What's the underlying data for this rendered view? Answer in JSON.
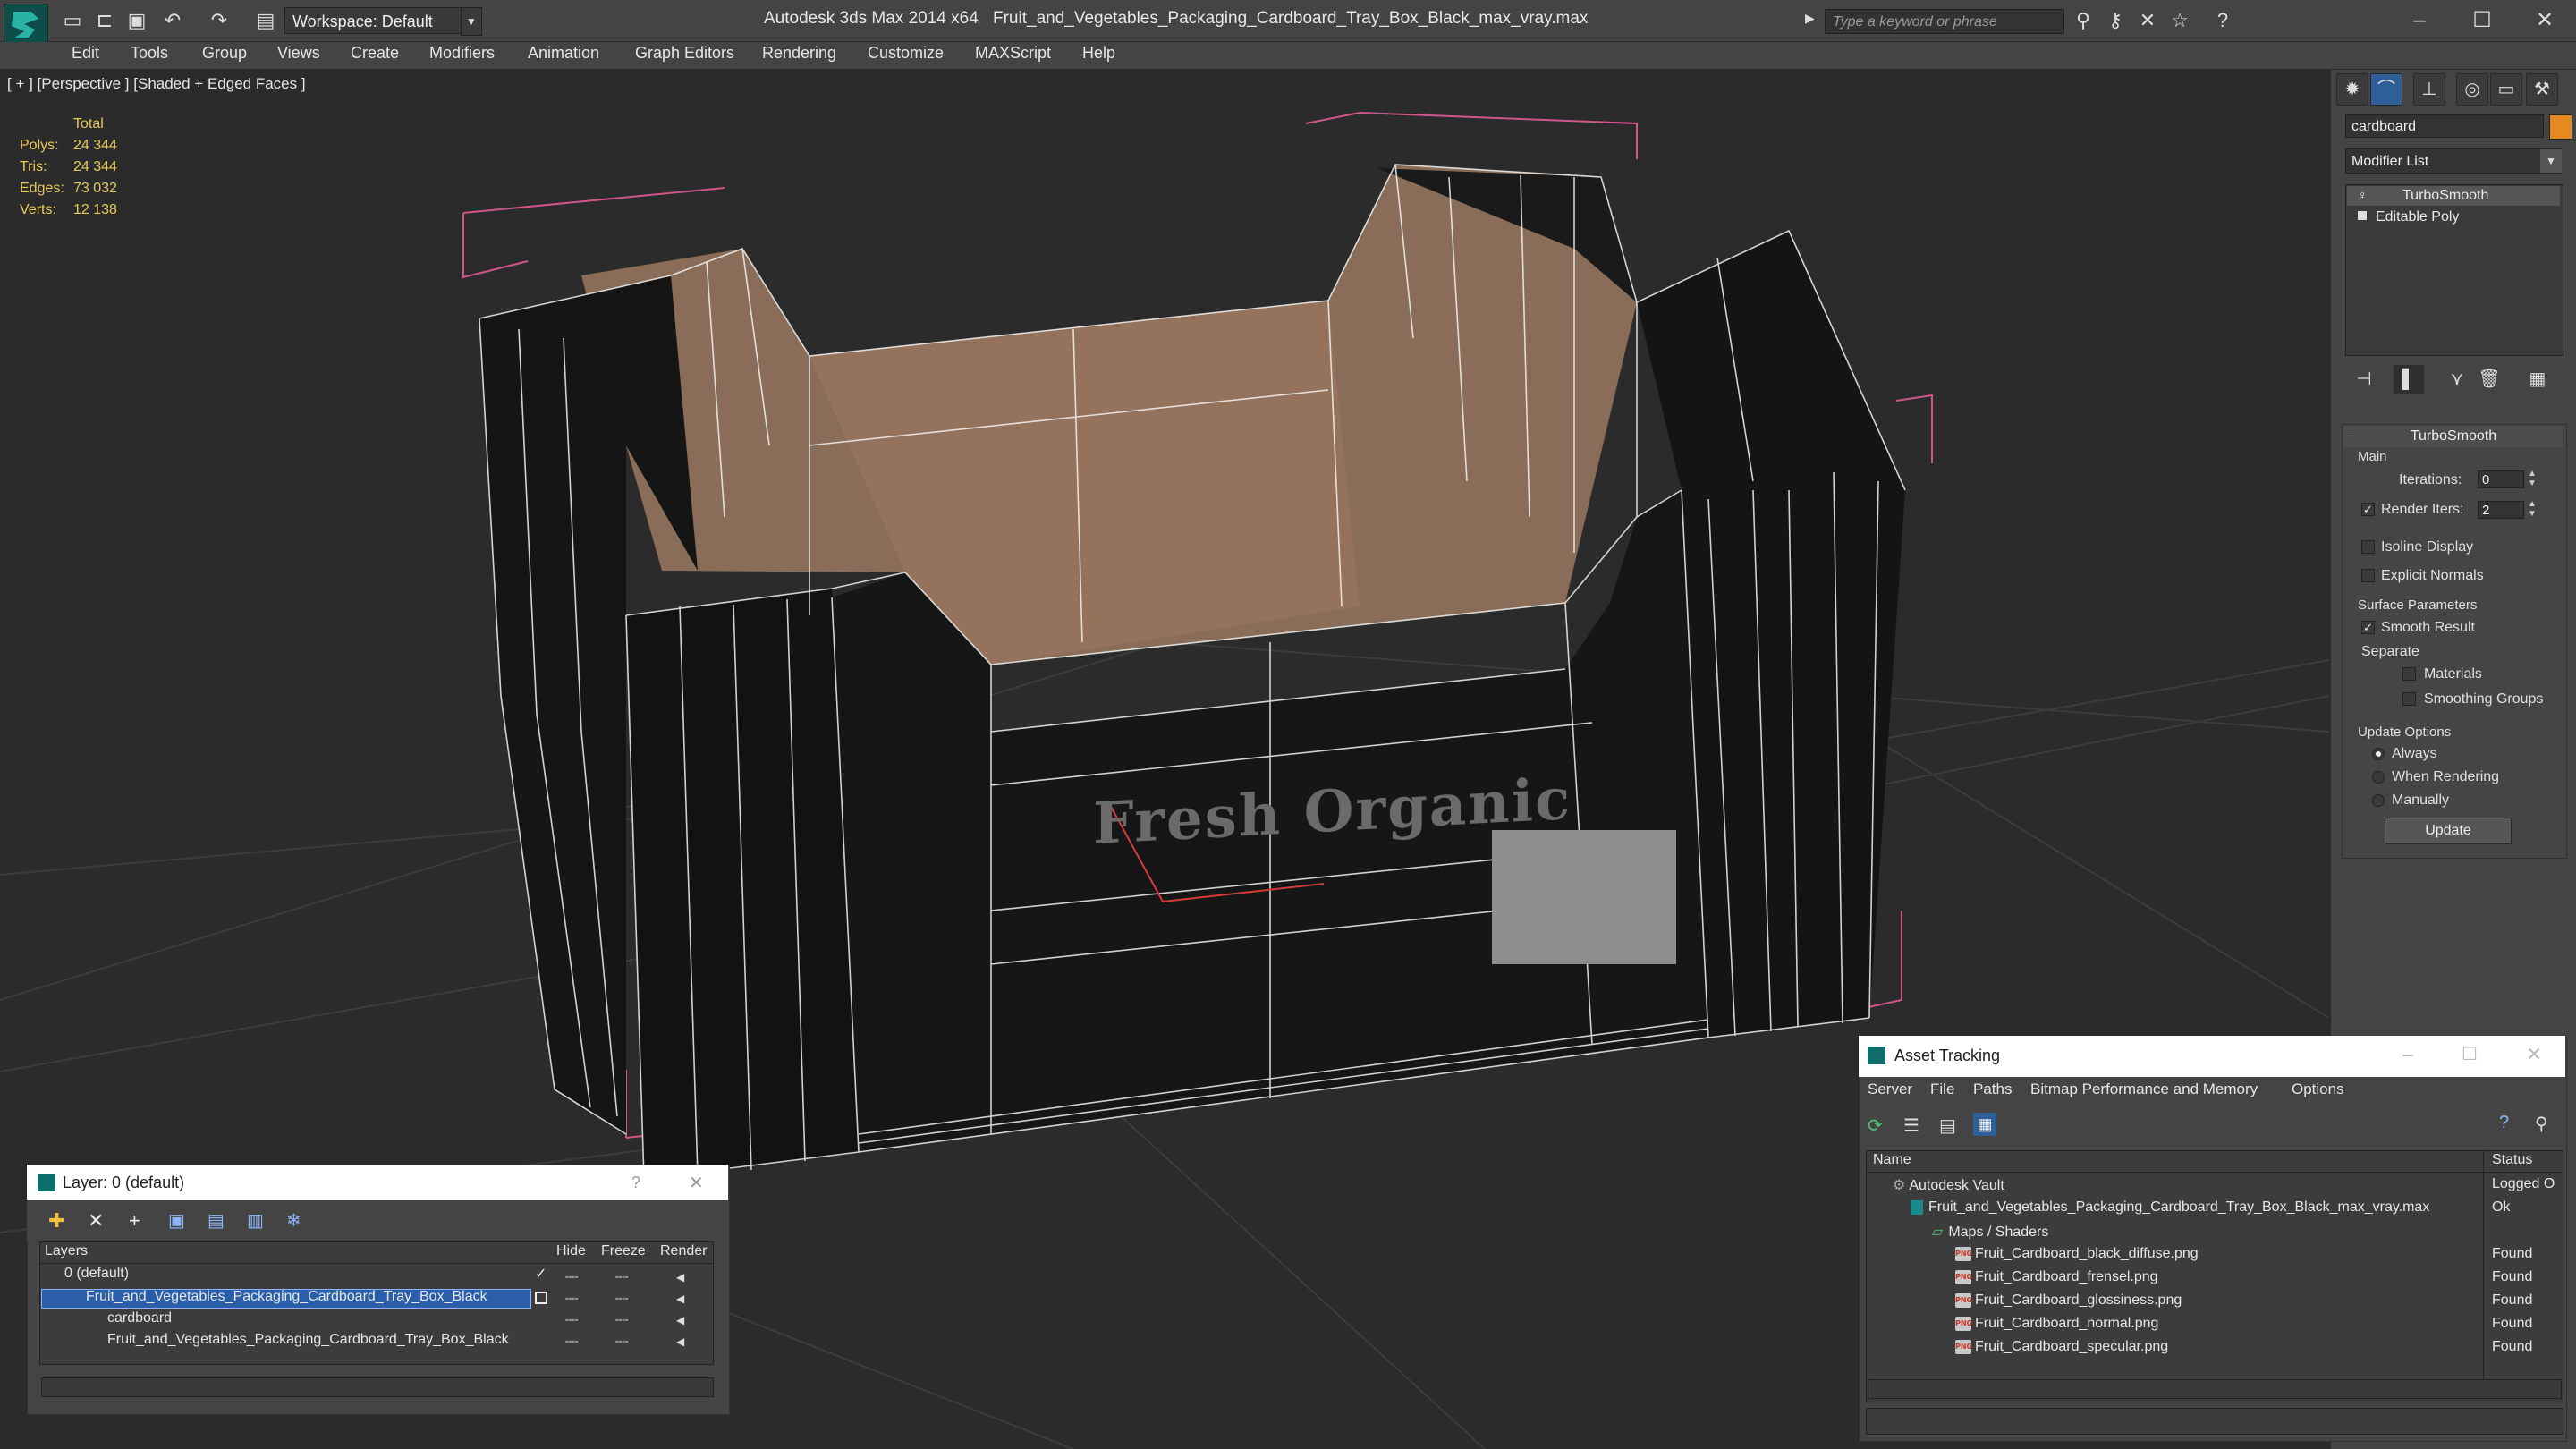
{
  "app": {
    "title": "Autodesk 3ds Max  2014 x64",
    "file": "Fruit_and_Vegetables_Packaging_Cardboard_Tray_Box_Black_max_vray.max",
    "workspace": "Workspace: Default",
    "search_placeholder": "Type a keyword or phrase"
  },
  "menu": [
    "Edit",
    "Tools",
    "Group",
    "Views",
    "Create",
    "Modifiers",
    "Animation",
    "Graph Editors",
    "Rendering",
    "Customize",
    "MAXScript",
    "Help"
  ],
  "viewport": {
    "label": "[ + ] [Perspective ] [Shaded + Edged Faces ]",
    "stats": {
      "header": "Total",
      "rows": [
        {
          "label": "Polys:",
          "value": "24 344"
        },
        {
          "label": "Tris:",
          "value": "24 344"
        },
        {
          "label": "Edges:",
          "value": "73 032"
        },
        {
          "label": "Verts:",
          "value": "12 138"
        }
      ]
    },
    "box_print": "Fresh Organic"
  },
  "command_panel": {
    "object_name": "cardboard",
    "object_color": "#e58a1f",
    "modifier_list": "Modifier List",
    "stack": [
      "TurboSmooth",
      "Editable Poly"
    ],
    "rollout_title": "TurboSmooth",
    "main_label": "Main",
    "iterations_label": "Iterations:",
    "iterations_value": "0",
    "render_iters_label": "Render Iters:",
    "render_iters_value": "2",
    "render_iters_checked": true,
    "isoline": "Isoline Display",
    "explicit_normals": "Explicit Normals",
    "surface_params": "Surface Parameters",
    "smooth_result": "Smooth Result",
    "separate": "Separate",
    "materials": "Materials",
    "smoothing_groups": "Smoothing Groups",
    "update_options": "Update Options",
    "always": "Always",
    "when_rendering": "When Rendering",
    "manually": "Manually",
    "update_button": "Update"
  },
  "layer_window": {
    "title": "Layer: 0 (default)",
    "help": "?",
    "columns": [
      "Layers",
      "Hide",
      "Freeze",
      "Render"
    ],
    "rows": [
      {
        "name": "0 (default)"
      },
      {
        "name": "Fruit_and_Vegetables_Packaging_Cardboard_Tray_Box_Black"
      },
      {
        "name": "cardboard"
      },
      {
        "name": "Fruit_and_Vegetables_Packaging_Cardboard_Tray_Box_Black"
      }
    ]
  },
  "asset_window": {
    "title": "Asset Tracking",
    "menu": [
      "Server",
      "File",
      "Paths",
      "Bitmap Performance and Memory",
      "Options"
    ],
    "columns": [
      "Name",
      "Status"
    ],
    "rows": [
      {
        "name": "Autodesk Vault",
        "status": "Logged O"
      },
      {
        "name": "Fruit_and_Vegetables_Packaging_Cardboard_Tray_Box_Black_max_vray.max",
        "status": "Ok"
      },
      {
        "name": "Maps / Shaders",
        "status": ""
      },
      {
        "name": "Fruit_Cardboard_black_diffuse.png",
        "status": "Found"
      },
      {
        "name": "Fruit_Cardboard_frensel.png",
        "status": "Found"
      },
      {
        "name": "Fruit_Cardboard_glossiness.png",
        "status": "Found"
      },
      {
        "name": "Fruit_Cardboard_normal.png",
        "status": "Found"
      },
      {
        "name": "Fruit_Cardboard_specular.png",
        "status": "Found"
      }
    ]
  }
}
